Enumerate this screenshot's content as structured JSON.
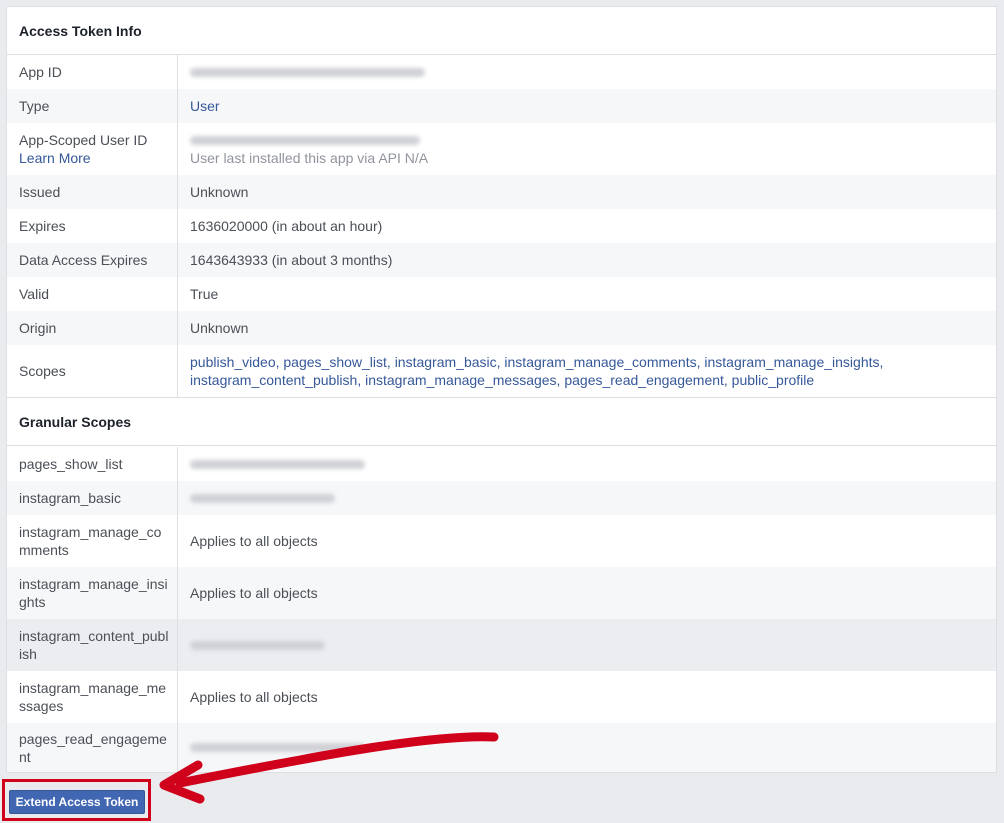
{
  "sections": {
    "token_info_title": "Access Token Info",
    "granular_title": "Granular Scopes"
  },
  "token_info": {
    "app_id_label": "App ID",
    "type_label": "Type",
    "type_value": "User",
    "app_scoped_label": "App-Scoped User ID",
    "learn_more": "Learn More",
    "install_note": "User last installed this app via API N/A",
    "issued_label": "Issued",
    "issued_value": "Unknown",
    "expires_label": "Expires",
    "expires_value": "1636020000 (in about an hour)",
    "data_access_label": "Data Access Expires",
    "data_access_value": "1643643933 (in about 3 months)",
    "valid_label": "Valid",
    "valid_value": "True",
    "origin_label": "Origin",
    "origin_value": "Unknown",
    "scopes_label": "Scopes",
    "scopes_line1": "publish_video, pages_show_list, instagram_basic, instagram_manage_comments, instagram_manage_insights,",
    "scopes_line2": "instagram_content_publish, instagram_manage_messages, pages_read_engagement, public_profile"
  },
  "granular": [
    {
      "label": "pages_show_list",
      "value": ""
    },
    {
      "label": "instagram_basic",
      "value": ""
    },
    {
      "label": "instagram_manage_comments",
      "value": "Applies to all objects"
    },
    {
      "label": "instagram_manage_insights",
      "value": "Applies to all objects"
    },
    {
      "label": "instagram_content_publish",
      "value": ""
    },
    {
      "label": "instagram_manage_messages",
      "value": "Applies to all objects"
    },
    {
      "label": "pages_read_engagement",
      "value": ""
    }
  ],
  "actions": {
    "extend_label": "Extend Access Token"
  },
  "colors": {
    "link": "#365899",
    "button": "#4267b2",
    "highlight": "#d0021b"
  }
}
